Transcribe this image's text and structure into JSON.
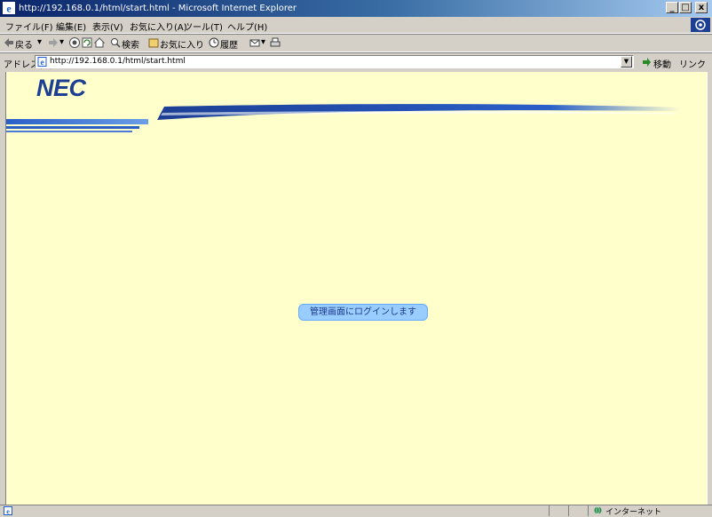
{
  "window": {
    "title": "http://192.168.0.1/html/start.html - Microsoft Internet Explorer",
    "minimize_glyph": "_",
    "maximize_glyph": "□",
    "close_glyph": "x"
  },
  "menubar": {
    "items": [
      "ファイル(F)",
      "編集(E)",
      "表示(V)",
      "お気に入り(A)",
      "ツール(T)",
      "ヘルプ(H)"
    ]
  },
  "toolbar": {
    "back_label": "戻る",
    "search_label": "検索",
    "favorites_label": "お気に入り",
    "history_label": "履歴"
  },
  "addressbar": {
    "label": "アドレス(D)",
    "url": "http://192.168.0.1/html/start.html",
    "go_label": "移動",
    "links_label": "リンク"
  },
  "content": {
    "logo": "NEC",
    "login_button_label": "管理画面にログインします"
  },
  "statusbar": {
    "zone_label": "インターネット"
  },
  "colors": {
    "content_background": "#ffffcc",
    "brand_blue": "#1c3f94",
    "button_fill": "#99ccff"
  },
  "icons": [
    "ie-icon",
    "back-arrow-icon",
    "forward-arrow-icon",
    "stop-icon",
    "refresh-icon",
    "home-icon",
    "search-icon",
    "favorites-icon",
    "history-icon",
    "mail-icon",
    "print-icon",
    "page-icon",
    "go-arrow-icon",
    "globe-icon"
  ]
}
